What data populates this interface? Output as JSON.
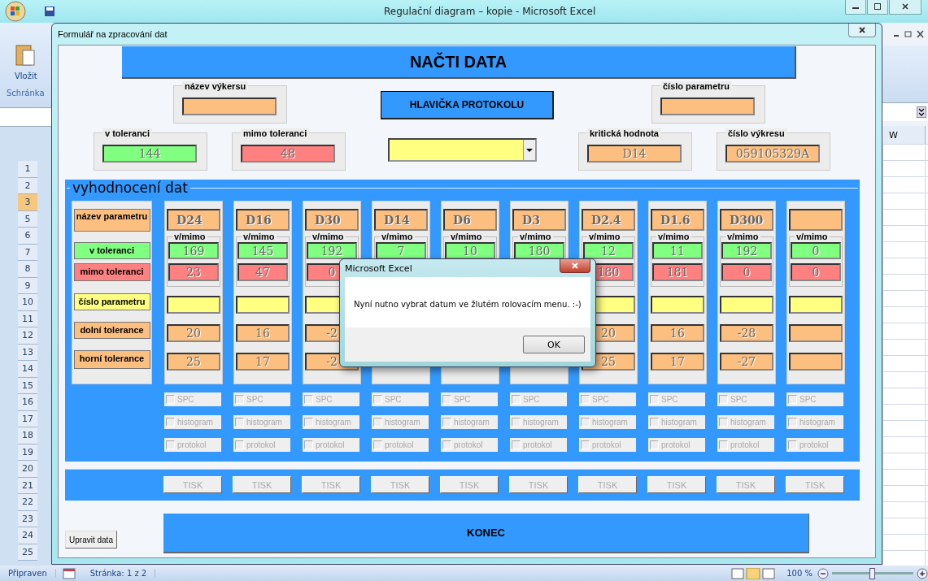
{
  "excel_window": {
    "title": "Regulační diagram – kopie - Microsoft Excel"
  },
  "ribbon": {
    "paste_label": "Vložit",
    "group_label": "Schránka"
  },
  "column_header": "W",
  "row_headers": [
    {
      "label": "1",
      "selected": false
    },
    {
      "label": "2",
      "selected": false
    },
    {
      "label": "3",
      "selected": true
    },
    {
      "label": "5",
      "selected": false
    },
    {
      "label": "6",
      "selected": false
    },
    {
      "label": "7",
      "selected": false
    },
    {
      "label": "8",
      "selected": false
    },
    {
      "label": "9",
      "selected": false
    },
    {
      "label": "10",
      "selected": false
    },
    {
      "label": "11",
      "selected": false
    },
    {
      "label": "12",
      "selected": false
    },
    {
      "label": "13",
      "selected": false
    },
    {
      "label": "14",
      "selected": false
    },
    {
      "label": "15",
      "selected": false
    },
    {
      "label": "16",
      "selected": false
    },
    {
      "label": "17",
      "selected": false
    },
    {
      "label": "18",
      "selected": false
    },
    {
      "label": "19",
      "selected": false
    },
    {
      "label": "20",
      "selected": false
    },
    {
      "label": "21",
      "selected": false
    },
    {
      "label": "22",
      "selected": false
    },
    {
      "label": "23",
      "selected": false
    },
    {
      "label": "24",
      "selected": false
    },
    {
      "label": "25",
      "selected": false
    }
  ],
  "status_bar": {
    "status": "Připraven",
    "page": "Stránka: 1 z 2",
    "zoom": "100 %",
    "zoom_slider": {
      "level": 0.5
    }
  },
  "form": {
    "title": "Formulář na zpracování dat",
    "load_button": "NAČTI DATA",
    "header_button": "HLAVIČKA PROTOKOLU",
    "top_fields": [
      {
        "label": "název výkersu",
        "color": "#fdbf80"
      },
      {
        "label": "číslo parametru",
        "color": "#fdbf80"
      }
    ],
    "fields": [
      {
        "label": "v toleranci",
        "value": "144",
        "color": "#80ff80"
      },
      {
        "label": "mimo toleranci",
        "value": "48",
        "color": "#ff8080"
      },
      {
        "label": "kritická hodnota",
        "value": "D14",
        "color": "#fdbf80"
      },
      {
        "label": "číslo výkresu",
        "value": "059105329A",
        "color": "#fdbf80"
      }
    ],
    "section_title": "vyhodnocení dat",
    "row_labels": [
      {
        "label": "název parametru",
        "color": "#fdbf80"
      },
      {
        "label": "v toleranci",
        "color": "#80ff80"
      },
      {
        "label": "mimo toleranci",
        "color": "#ff8080"
      },
      {
        "label": "číslo parametru",
        "color": "#ffff80"
      },
      {
        "label": "dolní tolerance",
        "color": "#fdbf80"
      },
      {
        "label": "horní tolerance",
        "color": "#fdbf80"
      }
    ],
    "columns": [
      {
        "name": "D24",
        "group_label": "v/mimo",
        "in_tolerance": "169",
        "out_of_tolerance": "23",
        "lower": "20",
        "upper": "25",
        "options": [
          {
            "label": "SPC",
            "checked": false
          },
          {
            "label": "histogram",
            "checked": false
          },
          {
            "label": "protokol",
            "checked": false
          }
        ],
        "print_button": "TISK"
      },
      {
        "name": "D16",
        "group_label": "v/mimo",
        "in_tolerance": "145",
        "out_of_tolerance": "47",
        "lower": "16",
        "upper": "17",
        "options": [
          {
            "label": "SPC",
            "checked": false
          },
          {
            "label": "histogram",
            "checked": false
          },
          {
            "label": "protokol",
            "checked": false
          }
        ],
        "print_button": "TISK"
      },
      {
        "name": "D30",
        "group_label": "v/mimo",
        "in_tolerance": "192",
        "out_of_tolerance": "0",
        "lower": "-2",
        "upper": "-2",
        "options": [
          {
            "label": "SPC",
            "checked": false
          },
          {
            "label": "histogram",
            "checked": false
          },
          {
            "label": "protokol",
            "checked": false
          }
        ],
        "print_button": "TISK"
      },
      {
        "name": "D14",
        "group_label": "v/mimo",
        "in_tolerance": "7",
        "options": [
          {
            "label": "SPC",
            "checked": false
          },
          {
            "label": "histogram",
            "checked": false
          },
          {
            "label": "protokol",
            "checked": false
          }
        ],
        "print_button": "TISK"
      },
      {
        "name": "D6",
        "group_label": "v/mimo",
        "in_tolerance": "10",
        "options": [
          {
            "label": "SPC",
            "checked": false
          },
          {
            "label": "histogram",
            "checked": false
          },
          {
            "label": "protokol",
            "checked": false
          }
        ],
        "print_button": "TISK"
      },
      {
        "name": "D3",
        "group_label": "v/mimo",
        "in_tolerance": "180",
        "options": [
          {
            "label": "SPC",
            "checked": false
          },
          {
            "label": "histogram",
            "checked": false
          },
          {
            "label": "protokol",
            "checked": false
          }
        ],
        "print_button": "TISK"
      },
      {
        "name": "D2.4",
        "group_label": "v/mimo",
        "in_tolerance": "12",
        "out_of_tolerance": "180",
        "lower": "20",
        "upper": "25",
        "options": [
          {
            "label": "SPC",
            "checked": false
          },
          {
            "label": "histogram",
            "checked": false
          },
          {
            "label": "protokol",
            "checked": false
          }
        ],
        "print_button": "TISK"
      },
      {
        "name": "D1.6",
        "group_label": "v/mimo",
        "in_tolerance": "11",
        "out_of_tolerance": "181",
        "lower": "16",
        "upper": "17",
        "options": [
          {
            "label": "SPC",
            "checked": false
          },
          {
            "label": "histogram",
            "checked": false
          },
          {
            "label": "protokol",
            "checked": false
          }
        ],
        "print_button": "TISK"
      },
      {
        "name": "D300",
        "group_label": "v/mimo",
        "in_tolerance": "192",
        "out_of_tolerance": "0",
        "lower": "-28",
        "upper": "-27",
        "options": [
          {
            "label": "SPC",
            "checked": false
          },
          {
            "label": "histogram",
            "checked": false
          },
          {
            "label": "protokol",
            "checked": false
          }
        ],
        "print_button": "TISK"
      },
      {
        "group_label": "v/mimo",
        "in_tolerance": "0",
        "out_of_tolerance": "0",
        "options": [
          {
            "label": "SPC",
            "checked": false
          },
          {
            "label": "histogram",
            "checked": false
          },
          {
            "label": "protokol",
            "checked": false
          }
        ],
        "print_button": "TISK"
      }
    ],
    "end_button": "KONEC",
    "edit_button": "Upravit data"
  },
  "dialog": {
    "title": "Microsoft Excel",
    "message": "Nyní nutno vybrat datum ve žlutém rolovacím menu. :-)",
    "ok_button": "OK"
  }
}
